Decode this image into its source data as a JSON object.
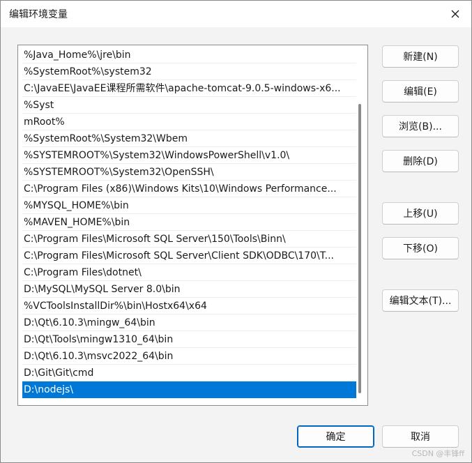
{
  "window": {
    "title": "编辑环境变量"
  },
  "list": {
    "items": [
      "%Java_Home%\\jre\\bin",
      "%SystemRoot%\\system32",
      "C:\\JavaEE\\JavaEE课程所需软件\\apache-tomcat-9.0.5-windows-x6...",
      "%Syst",
      "mRoot%",
      "%SystemRoot%\\System32\\Wbem",
      "%SYSTEMROOT%\\System32\\WindowsPowerShell\\v1.0\\",
      "%SYSTEMROOT%\\System32\\OpenSSH\\",
      "C:\\Program Files (x86)\\Windows Kits\\10\\Windows Performance...",
      "%MYSQL_HOME%\\bin",
      "%MAVEN_HOME%\\bin",
      "C:\\Program Files\\Microsoft SQL Server\\150\\Tools\\Binn\\",
      "C:\\Program Files\\Microsoft SQL Server\\Client SDK\\ODBC\\170\\T...",
      "C:\\Program Files\\dotnet\\",
      "D:\\MySQL\\MySQL Server 8.0\\bin",
      "%VCToolsInstallDir%\\bin\\Hostx64\\x64",
      "D:\\Qt\\6.10.3\\mingw_64\\bin",
      "D:\\Qt\\Tools\\mingw1310_64\\bin",
      "D:\\Qt\\6.10.3\\msvc2022_64\\bin",
      "D:\\Git\\Git\\cmd",
      "D:\\nodejs\\"
    ],
    "selected_index": 20
  },
  "buttons": {
    "new": "新建(N)",
    "edit": "编辑(E)",
    "browse": "浏览(B)...",
    "delete": "删除(D)",
    "move_up": "上移(U)",
    "move_down": "下移(O)",
    "edit_text": "编辑文本(T)...",
    "ok": "确定",
    "cancel": "取消"
  },
  "watermark": "CSDN @丰锋ff",
  "colors": {
    "selection": "#0078d7",
    "focus_border": "#0067c0",
    "dialog_bg": "#f3f3f3"
  },
  "icons": {
    "close": "close-icon"
  }
}
